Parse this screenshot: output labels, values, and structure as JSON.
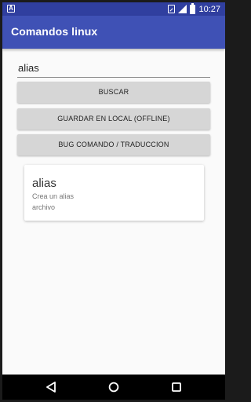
{
  "status_bar": {
    "notification_icon": "android-notification-icon",
    "time": "10:27"
  },
  "app_bar": {
    "title": "Comandos linux"
  },
  "search": {
    "value": "alias"
  },
  "buttons": {
    "buscar": "BUSCAR",
    "guardar": "GUARDAR EN LOCAL (OFFLINE)",
    "bug": "BUG COMANDO / TRADUCCION"
  },
  "result": {
    "title": "alias",
    "description": "Crea un alias",
    "extra": "archivo"
  },
  "nav": {
    "back": "back-triangle-icon",
    "home": "home-circle-icon",
    "recent": "recent-square-icon"
  },
  "colors": {
    "status_bar": "#303f9f",
    "app_bar": "#3f51b5",
    "button": "#d6d6d6",
    "background": "#fafafa"
  }
}
